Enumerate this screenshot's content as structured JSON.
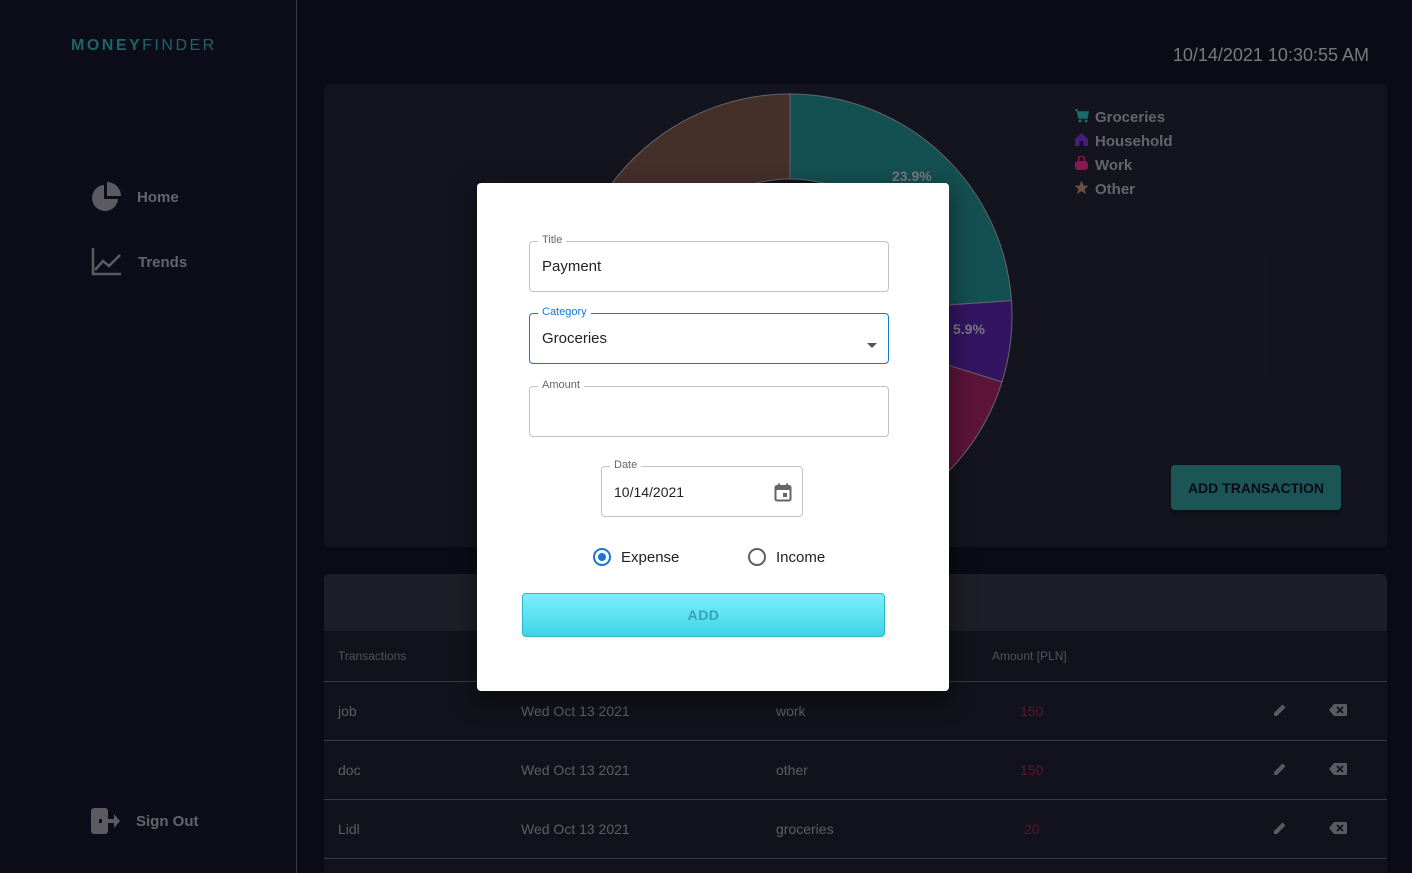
{
  "app": {
    "logo_bold": "MONEY",
    "logo_light": "FINDER",
    "clock": "10/14/2021 10:30:55 AM"
  },
  "sidebar": {
    "items": [
      {
        "label": "Home",
        "icon": "pie-chart-icon"
      },
      {
        "label": "Trends",
        "icon": "trend-line-icon"
      }
    ],
    "sign_out": {
      "label": "Sign Out",
      "icon": "logout-icon"
    }
  },
  "chart_data": {
    "type": "pie",
    "labels": [
      "Groceries",
      "Household",
      "Work",
      "Other"
    ],
    "values": [
      23.9,
      5.9,
      45.1,
      25.1
    ],
    "visible_labels": [
      "23.9%",
      "5.9%"
    ],
    "colors": [
      "#1f7a7d",
      "#4e1f96",
      "#8e1f57",
      "#6b4a3f"
    ],
    "legend_placement": "top-right"
  },
  "legend": [
    {
      "label": "Groceries",
      "icon": "cart-icon",
      "color": "#2aa7a9"
    },
    {
      "label": "Household",
      "icon": "house-icon",
      "color": "#6a2fc2"
    },
    {
      "label": "Work",
      "icon": "bag-icon",
      "color": "#d1257a"
    },
    {
      "label": "Other",
      "icon": "star-icon",
      "color": "#a57a66"
    }
  ],
  "add_transaction_label": "ADD TRANSACTION",
  "table": {
    "headers": [
      "Transactions",
      "Amount [PLN]"
    ],
    "rows": [
      {
        "name": "job",
        "date": "Wed Oct 13 2021",
        "category": "work",
        "amount": "150"
      },
      {
        "name": "doc",
        "date": "Wed Oct 13 2021",
        "category": "other",
        "amount": "150"
      },
      {
        "name": "Lidl",
        "date": "Wed Oct 13 2021",
        "category": "groceries",
        "amount": "20"
      }
    ]
  },
  "modal": {
    "title_label": "Title",
    "title_value": "Payment",
    "category_label": "Category",
    "category_value": "Groceries",
    "amount_label": "Amount",
    "amount_value": "",
    "date_label": "Date",
    "date_value": "10/14/2021",
    "expense_label": "Expense",
    "income_label": "Income",
    "type_selected": "Expense",
    "add_label": "ADD"
  }
}
